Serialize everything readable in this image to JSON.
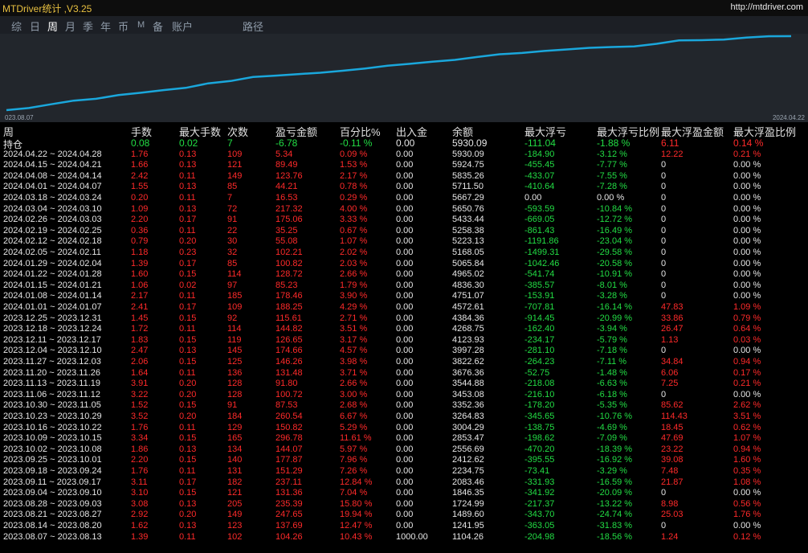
{
  "app": {
    "title": "MTDriver统计 ,V3.25",
    "site": "http://mtdriver.com"
  },
  "tabs": [
    {
      "label": "综",
      "active": false
    },
    {
      "label": "日",
      "active": false
    },
    {
      "label": "周",
      "active": true
    },
    {
      "label": "月",
      "active": false
    },
    {
      "label": "季",
      "active": false
    },
    {
      "label": "年",
      "active": false
    },
    {
      "label": "币",
      "active": false
    },
    {
      "label": "M",
      "active": false
    },
    {
      "label": "备",
      "active": false
    },
    {
      "label": "账户",
      "active": false
    },
    {
      "label": "路径",
      "active": false
    }
  ],
  "chart_data": {
    "type": "line",
    "x_start_label": "023.08.07",
    "x_end_label": "2024.04.22",
    "series_color": "#1aa7dc",
    "y": [
      1104.26,
      1241.95,
      1489.6,
      1724.99,
      1846.35,
      2083.46,
      2234.75,
      2412.62,
      2556.69,
      2853.47,
      3004.29,
      3264.83,
      3352.36,
      3453.08,
      3544.88,
      3676.36,
      3822.62,
      3997.28,
      4123.93,
      4268.75,
      4384.36,
      4572.61,
      4751.07,
      4836.3,
      4965.02,
      5065.84,
      5168.05,
      5223.13,
      5258.38,
      5433.44,
      5650.76,
      5667.29,
      5711.5,
      5835.26,
      5924.75,
      5930.09
    ]
  },
  "table": {
    "headers": [
      "周",
      "手数",
      "最大手数",
      "次数",
      "盈亏金额",
      "百分比%",
      "出入金",
      "余额",
      "最大浮亏",
      "最大浮亏比例",
      "最大浮盈金额",
      "最大浮盈比例"
    ],
    "holding": {
      "label": "持仓",
      "lots": "0.08",
      "max_lots": "0.02",
      "count": "7",
      "pnl": "-6.78",
      "pct": "-0.11 %",
      "flow": "0.00",
      "balance": "5930.09",
      "max_dd": "-111.04",
      "max_dd_pct": "-1.88 %",
      "max_fp": "6.11",
      "max_fp_pct": "0.14 %"
    },
    "rows": [
      [
        "2024.04.22 ~ 2024.04.28",
        "1.76",
        "0.13",
        "109",
        "5.34",
        "0.09 %",
        "0.00",
        "5930.09",
        "-184.90",
        "-3.12 %",
        "12.22",
        "0.21 %"
      ],
      [
        "2024.04.15 ~ 2024.04.21",
        "1.66",
        "0.13",
        "121",
        "89.49",
        "1.53 %",
        "0.00",
        "5924.75",
        "-455.45",
        "-7.77 %",
        "0",
        "0.00 %"
      ],
      [
        "2024.04.08 ~ 2024.04.14",
        "2.42",
        "0.11",
        "149",
        "123.76",
        "2.17 %",
        "0.00",
        "5835.26",
        "-433.07",
        "-7.55 %",
        "0",
        "0.00 %"
      ],
      [
        "2024.04.01 ~ 2024.04.07",
        "1.55",
        "0.13",
        "85",
        "44.21",
        "0.78 %",
        "0.00",
        "5711.50",
        "-410.64",
        "-7.28 %",
        "0",
        "0.00 %"
      ],
      [
        "2024.03.18 ~ 2024.03.24",
        "0.20",
        "0.11",
        "7",
        "16.53",
        "0.29 %",
        "0.00",
        "5667.29",
        "0.00",
        "0.00 %",
        "0",
        "0.00 %"
      ],
      [
        "2024.03.04 ~ 2024.03.10",
        "1.09",
        "0.13",
        "72",
        "217.32",
        "4.00 %",
        "0.00",
        "5650.76",
        "-593.59",
        "-10.84 %",
        "0",
        "0.00 %"
      ],
      [
        "2024.02.26 ~ 2024.03.03",
        "2.20",
        "0.17",
        "91",
        "175.06",
        "3.33 %",
        "0.00",
        "5433.44",
        "-669.05",
        "-12.72 %",
        "0",
        "0.00 %"
      ],
      [
        "2024.02.19 ~ 2024.02.25",
        "0.36",
        "0.11",
        "22",
        "35.25",
        "0.67 %",
        "0.00",
        "5258.38",
        "-861.43",
        "-16.49 %",
        "0",
        "0.00 %"
      ],
      [
        "2024.02.12 ~ 2024.02.18",
        "0.79",
        "0.20",
        "30",
        "55.08",
        "1.07 %",
        "0.00",
        "5223.13",
        "-1191.86",
        "-23.04 %",
        "0",
        "0.00 %"
      ],
      [
        "2024.02.05 ~ 2024.02.11",
        "1.18",
        "0.23",
        "32",
        "102.21",
        "2.02 %",
        "0.00",
        "5168.05",
        "-1499.31",
        "-29.58 %",
        "0",
        "0.00 %"
      ],
      [
        "2024.01.29 ~ 2024.02.04",
        "1.39",
        "0.17",
        "85",
        "100.82",
        "2.03 %",
        "0.00",
        "5065.84",
        "-1042.46",
        "-20.58 %",
        "0",
        "0.00 %"
      ],
      [
        "2024.01.22 ~ 2024.01.28",
        "1.60",
        "0.15",
        "114",
        "128.72",
        "2.66 %",
        "0.00",
        "4965.02",
        "-541.74",
        "-10.91 %",
        "0",
        "0.00 %"
      ],
      [
        "2024.01.15 ~ 2024.01.21",
        "1.06",
        "0.02",
        "97",
        "85.23",
        "1.79 %",
        "0.00",
        "4836.30",
        "-385.57",
        "-8.01 %",
        "0",
        "0.00 %"
      ],
      [
        "2024.01.08 ~ 2024.01.14",
        "2.17",
        "0.11",
        "185",
        "178.46",
        "3.90 %",
        "0.00",
        "4751.07",
        "-153.91",
        "-3.28 %",
        "0",
        "0.00 %"
      ],
      [
        "2024.01.01 ~ 2024.01.07",
        "2.41",
        "0.17",
        "109",
        "188.25",
        "4.29 %",
        "0.00",
        "4572.61",
        "-707.81",
        "-16.14 %",
        "47.83",
        "1.09 %"
      ],
      [
        "2023.12.25 ~ 2023.12.31",
        "1.45",
        "0.15",
        "92",
        "115.61",
        "2.71 %",
        "0.00",
        "4384.36",
        "-914.45",
        "-20.99 %",
        "33.86",
        "0.79 %"
      ],
      [
        "2023.12.18 ~ 2023.12.24",
        "1.72",
        "0.11",
        "114",
        "144.82",
        "3.51 %",
        "0.00",
        "4268.75",
        "-162.40",
        "-3.94 %",
        "26.47",
        "0.64 %"
      ],
      [
        "2023.12.11 ~ 2023.12.17",
        "1.83",
        "0.15",
        "119",
        "126.65",
        "3.17 %",
        "0.00",
        "4123.93",
        "-234.17",
        "-5.79 %",
        "1.13",
        "0.03 %"
      ],
      [
        "2023.12.04 ~ 2023.12.10",
        "2.47",
        "0.13",
        "145",
        "174.66",
        "4.57 %",
        "0.00",
        "3997.28",
        "-281.10",
        "-7.18 %",
        "0",
        "0.00 %"
      ],
      [
        "2023.11.27 ~ 2023.12.03",
        "2.06",
        "0.15",
        "125",
        "146.26",
        "3.98 %",
        "0.00",
        "3822.62",
        "-264.23",
        "-7.11 %",
        "34.84",
        "0.94 %"
      ],
      [
        "2023.11.20 ~ 2023.11.26",
        "1.64",
        "0.11",
        "136",
        "131.48",
        "3.71 %",
        "0.00",
        "3676.36",
        "-52.75",
        "-1.48 %",
        "6.06",
        "0.17 %"
      ],
      [
        "2023.11.13 ~ 2023.11.19",
        "3.91",
        "0.20",
        "128",
        "91.80",
        "2.66 %",
        "0.00",
        "3544.88",
        "-218.08",
        "-6.63 %",
        "7.25",
        "0.21 %"
      ],
      [
        "2023.11.06 ~ 2023.11.12",
        "3.22",
        "0.20",
        "128",
        "100.72",
        "3.00 %",
        "0.00",
        "3453.08",
        "-216.10",
        "-6.18 %",
        "0",
        "0.00 %"
      ],
      [
        "2023.10.30 ~ 2023.11.05",
        "1.52",
        "0.15",
        "91",
        "87.53",
        "2.68 %",
        "0.00",
        "3352.36",
        "-178.20",
        "-5.35 %",
        "85.62",
        "2.62 %"
      ],
      [
        "2023.10.23 ~ 2023.10.29",
        "3.52",
        "0.20",
        "184",
        "260.54",
        "6.67 %",
        "0.00",
        "3264.83",
        "-345.65",
        "-10.76 %",
        "114.43",
        "3.51 %"
      ],
      [
        "2023.10.16 ~ 2023.10.22",
        "1.76",
        "0.11",
        "129",
        "150.82",
        "5.29 %",
        "0.00",
        "3004.29",
        "-138.75",
        "-4.69 %",
        "18.45",
        "0.62 %"
      ],
      [
        "2023.10.09 ~ 2023.10.15",
        "3.34",
        "0.15",
        "165",
        "296.78",
        "11.61 %",
        "0.00",
        "2853.47",
        "-198.62",
        "-7.09 %",
        "47.69",
        "1.07 %"
      ],
      [
        "2023.10.02 ~ 2023.10.08",
        "1.86",
        "0.13",
        "134",
        "144.07",
        "5.97 %",
        "0.00",
        "2556.69",
        "-470.20",
        "-18.39 %",
        "23.22",
        "0.94 %"
      ],
      [
        "2023.09.25 ~ 2023.10.01",
        "2.20",
        "0.15",
        "140",
        "177.87",
        "7.96 %",
        "0.00",
        "2412.62",
        "-395.55",
        "-16.92 %",
        "39.08",
        "1.60 %"
      ],
      [
        "2023.09.18 ~ 2023.09.24",
        "1.76",
        "0.11",
        "131",
        "151.29",
        "7.26 %",
        "0.00",
        "2234.75",
        "-73.41",
        "-3.29 %",
        "7.48",
        "0.35 %"
      ],
      [
        "2023.09.11 ~ 2023.09.17",
        "3.11",
        "0.17",
        "182",
        "237.11",
        "12.84 %",
        "0.00",
        "2083.46",
        "-331.93",
        "-16.59 %",
        "21.87",
        "1.08 %"
      ],
      [
        "2023.09.04 ~ 2023.09.10",
        "3.10",
        "0.15",
        "121",
        "131.36",
        "7.04 %",
        "0.00",
        "1846.35",
        "-341.92",
        "-20.09 %",
        "0",
        "0.00 %"
      ],
      [
        "2023.08.28 ~ 2023.09.03",
        "3.08",
        "0.13",
        "205",
        "235.39",
        "15.80 %",
        "0.00",
        "1724.99",
        "-217.37",
        "-13.22 %",
        "8.98",
        "0.56 %"
      ],
      [
        "2023.08.21 ~ 2023.08.27",
        "2.92",
        "0.20",
        "149",
        "247.65",
        "19.94 %",
        "0.00",
        "1489.60",
        "-343.70",
        "-24.74 %",
        "25.03",
        "1.76 %"
      ],
      [
        "2023.08.14 ~ 2023.08.20",
        "1.62",
        "0.13",
        "123",
        "137.69",
        "12.47 %",
        "0.00",
        "1241.95",
        "-363.05",
        "-31.83 %",
        "0",
        "0.00 %"
      ],
      [
        "2023.08.07 ~ 2023.08.13",
        "1.39",
        "0.11",
        "102",
        "104.26",
        "10.43 %",
        "1000.00",
        "1104.26",
        "-204.98",
        "-18.56 %",
        "1.24",
        "0.12 %"
      ]
    ]
  }
}
